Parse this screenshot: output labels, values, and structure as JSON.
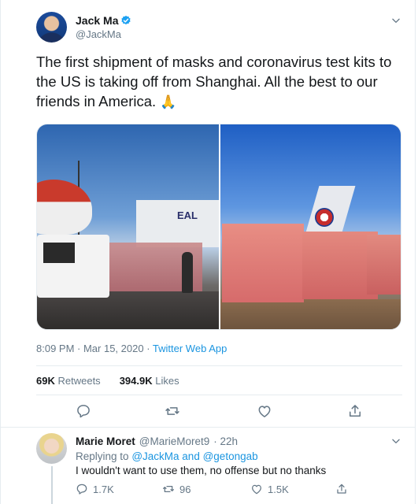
{
  "tweet": {
    "author_name": "Jack Ma",
    "author_handle": "@JackMa",
    "text": "The first shipment of masks and coronavirus test kits to the US is taking off from Shanghai. All the best to our friends in America.",
    "emoji": "🙏",
    "time": "8:09 PM · Mar 15, 2020",
    "separator": " · ",
    "source": "Twitter Web App",
    "retweets_count": "69K",
    "retweets_label": "Retweets",
    "likes_count": "394.9K",
    "likes_label": "Likes",
    "photo_sign": "EAL"
  },
  "reply": {
    "author_name": "Marie Moret",
    "author_handle": "@MarieMoret9",
    "time_ago": "· 22h",
    "replying_prefix": "Replying to",
    "mention_1": "@JackMa",
    "and_word": "and",
    "mention_2": "@getongab",
    "text": "I wouldn't want to use them, no offense but no thanks",
    "reply_count": "1.7K",
    "retweet_count": "96",
    "like_count": "1.5K"
  },
  "colors": {
    "accent": "#1b95e0",
    "text_primary": "#14171a",
    "text_secondary": "#657786",
    "divider": "#e6ecf0"
  },
  "icons": {
    "verified": "verified-badge-icon",
    "menu": "chevron-down-icon",
    "reply": "reply-icon",
    "retweet": "retweet-icon",
    "like": "heart-icon",
    "share": "share-icon"
  }
}
